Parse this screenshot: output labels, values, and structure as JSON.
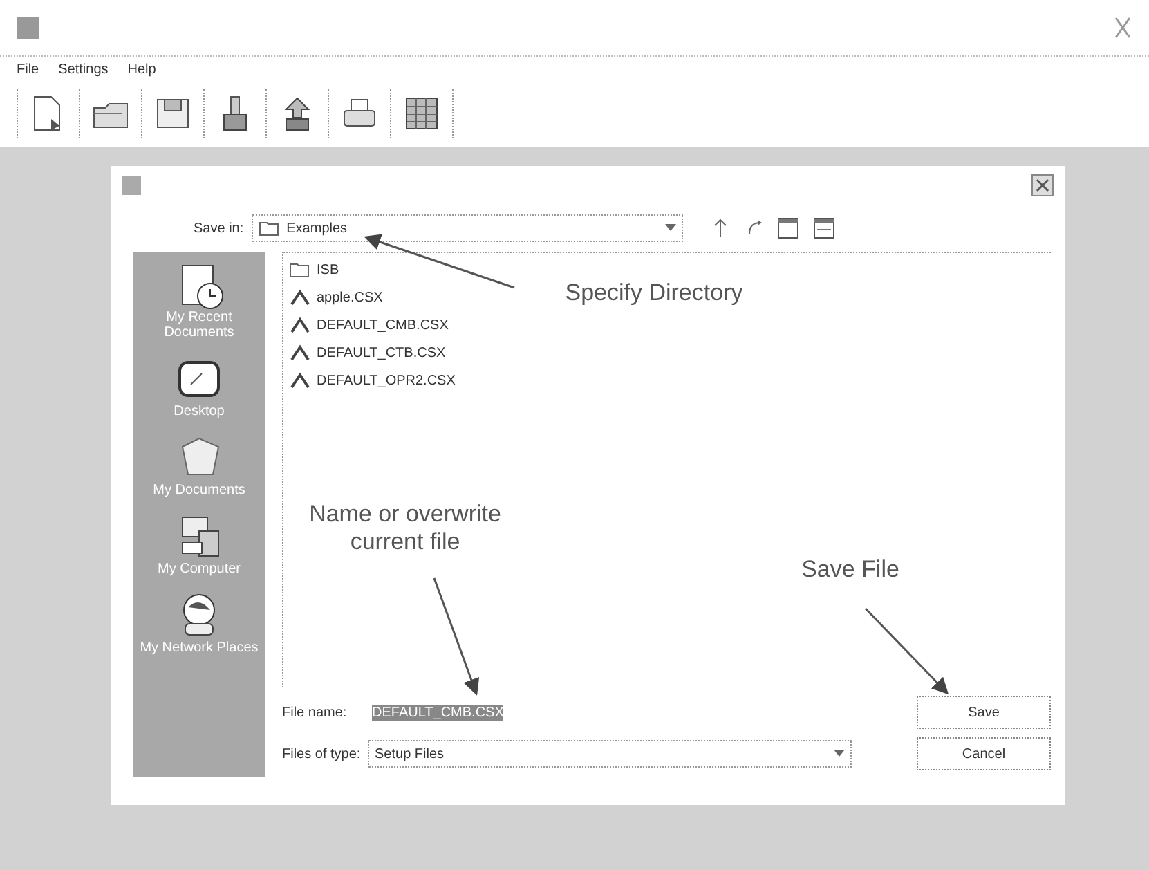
{
  "menu": [
    {
      "label": "File"
    },
    {
      "label": "Settings"
    },
    {
      "label": "Help"
    }
  ],
  "toolbar": [
    {
      "kind": "new"
    },
    {
      "kind": "open"
    },
    {
      "kind": "save"
    },
    {
      "kind": "brush"
    },
    {
      "kind": "upload"
    },
    {
      "kind": "print"
    },
    {
      "kind": "table"
    }
  ],
  "dialog": {
    "save_in": {
      "label": "Save in:",
      "value": "Examples"
    },
    "places": [
      {
        "label": "My Recent Documents",
        "kind": "recent"
      },
      {
        "label": "Desktop",
        "kind": "desktop"
      },
      {
        "label": "My Documents",
        "kind": "documents"
      },
      {
        "label": "My Computer",
        "kind": "computer"
      },
      {
        "label": "My Network Places",
        "kind": "network"
      }
    ],
    "files": [
      {
        "name": "ISB",
        "kind": "folder"
      },
      {
        "name": "apple.CSX",
        "kind": "file"
      },
      {
        "name": "DEFAULT_CMB.CSX",
        "kind": "file"
      },
      {
        "name": "DEFAULT_CTB.CSX",
        "kind": "file"
      },
      {
        "name": "DEFAULT_OPR2.CSX",
        "kind": "file"
      }
    ],
    "file_name": {
      "label": "File name:",
      "value": "DEFAULT_CMB.CSX",
      "selected": true
    },
    "file_type": {
      "label": "Files of type:",
      "value": "Setup Files"
    },
    "buttons": [
      {
        "label": "Save"
      },
      {
        "label": "Cancel"
      }
    ]
  },
  "annotations": [
    {
      "text": "Specify Directory"
    },
    {
      "text": "Name or overwrite current file"
    },
    {
      "text": "Save File"
    }
  ]
}
